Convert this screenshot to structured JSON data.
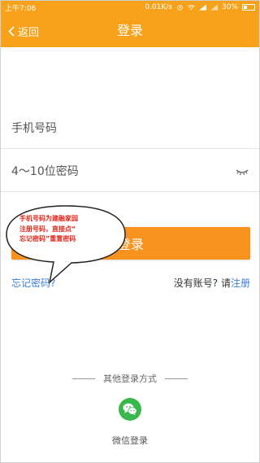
{
  "status_bar": {
    "time": "上午7:06",
    "speed": "0.01K/s",
    "battery": "30%"
  },
  "header": {
    "back_label": "返回",
    "title": "登录"
  },
  "form": {
    "phone_placeholder": "手机号码",
    "password_placeholder": "4～10位密码",
    "login_label": "登录",
    "forgot_label": "忘记密码?",
    "no_account_label": "没有账号? 请",
    "register_label": "注册"
  },
  "annotation": {
    "lines": [
      "手机号码为建融家园",
      "注册号码，直接点“",
      "忘记密码”重置密码"
    ]
  },
  "other_login": {
    "label": "其他登录方式",
    "wechat_label": "微信登录"
  },
  "colors": {
    "accent": "#f7a21a",
    "button": "#f7931e",
    "link": "#3a7dd8",
    "annotation_text": "#e2281b",
    "wechat": "#38b84a"
  },
  "icons": {
    "back": "chevron-left-icon",
    "password_toggle": "eye-closed-icon",
    "wechat": "wechat-icon"
  }
}
